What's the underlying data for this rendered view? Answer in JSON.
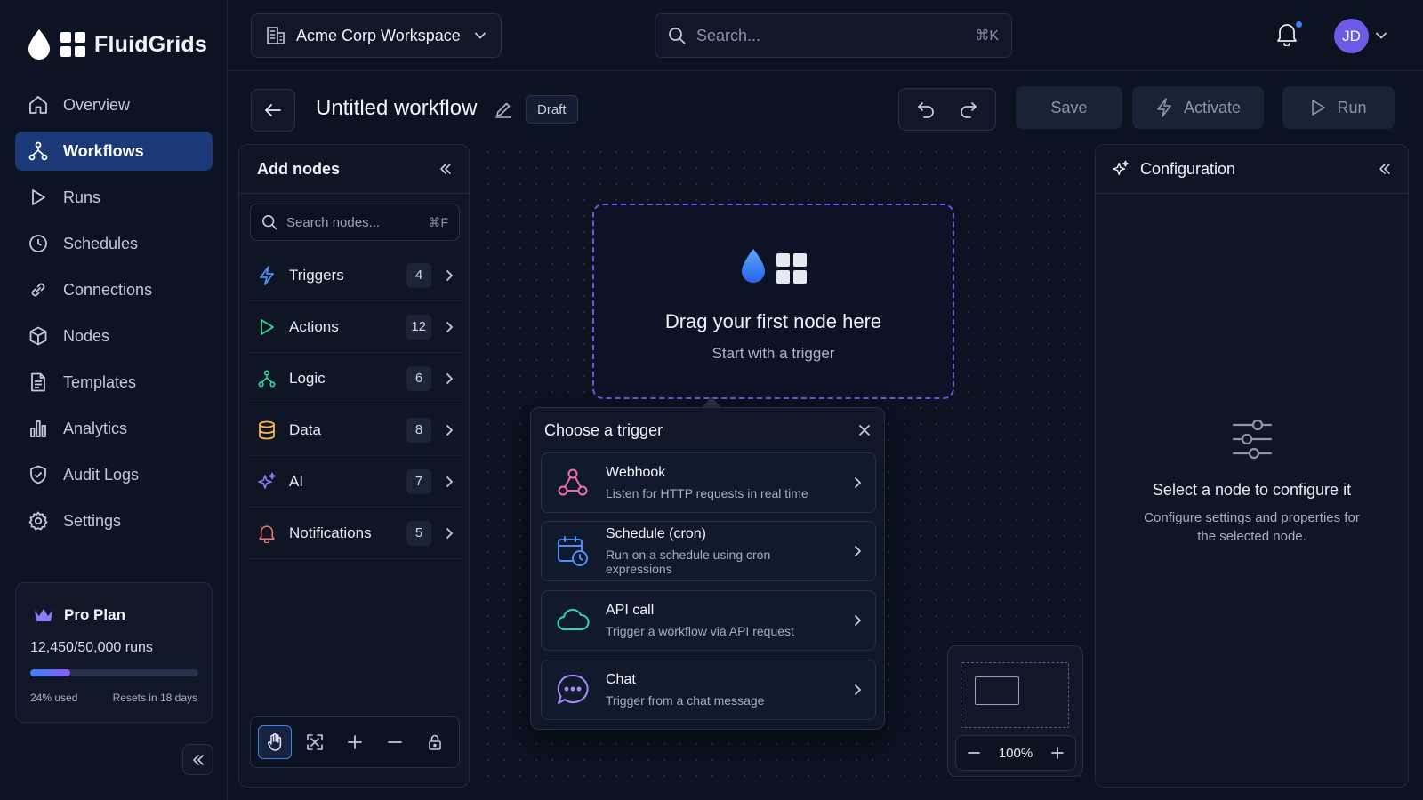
{
  "app": {
    "name": "FluidGrids"
  },
  "sidebar": {
    "items": [
      {
        "label": "Overview",
        "icon": "home-icon",
        "active": false
      },
      {
        "label": "Workflows",
        "icon": "workflow-icon",
        "active": true
      },
      {
        "label": "Runs",
        "icon": "play-icon",
        "active": false
      },
      {
        "label": "Schedules",
        "icon": "clock-icon",
        "active": false
      },
      {
        "label": "Connections",
        "icon": "link-icon",
        "active": false
      },
      {
        "label": "Nodes",
        "icon": "cube-icon",
        "active": false
      },
      {
        "label": "Templates",
        "icon": "document-icon",
        "active": false
      },
      {
        "label": "Analytics",
        "icon": "bar-chart-icon",
        "active": false
      },
      {
        "label": "Audit Logs",
        "icon": "shield-icon",
        "active": false
      },
      {
        "label": "Settings",
        "icon": "gear-icon",
        "active": false
      }
    ],
    "plan": {
      "name": "Pro Plan",
      "runs": "12,450/50,000 runs",
      "used_fraction": 0.24,
      "used_label": "24% used",
      "reset_label": "Resets in 18 days"
    }
  },
  "topbar": {
    "workspace": "Acme Corp Workspace",
    "search_placeholder": "Search...",
    "search_shortcut": "⌘K",
    "avatar_initials": "JD"
  },
  "workflow": {
    "title": "Untitled workflow",
    "status": "Draft",
    "save_label": "Save",
    "activate_label": "Activate",
    "run_label": "Run"
  },
  "add_nodes": {
    "title": "Add nodes",
    "search_placeholder": "Search nodes...",
    "search_shortcut": "⌘F",
    "categories": [
      {
        "label": "Triggers",
        "count": "4",
        "icon": "bolt-icon",
        "color": "#4f8ef7"
      },
      {
        "label": "Actions",
        "count": "12",
        "icon": "play-icon",
        "color": "#34d399"
      },
      {
        "label": "Logic",
        "count": "6",
        "icon": "branch-icon",
        "color": "#34d399"
      },
      {
        "label": "Data",
        "count": "8",
        "icon": "database-icon",
        "color": "#f5b94a"
      },
      {
        "label": "AI",
        "count": "7",
        "icon": "sparkle-icon",
        "color": "#8b7cf6"
      },
      {
        "label": "Notifications",
        "count": "5",
        "icon": "bell-icon",
        "color": "#f47272"
      }
    ]
  },
  "canvas": {
    "drop_title": "Drag your first node here",
    "drop_subtitle": "Start with a trigger",
    "zoom": "100%"
  },
  "trigger_picker": {
    "title": "Choose a trigger",
    "options": [
      {
        "title": "Webhook",
        "subtitle": "Listen for HTTP requests in real time",
        "icon": "webhook-icon"
      },
      {
        "title": "Schedule (cron)",
        "subtitle": "Run on a schedule using cron expressions",
        "icon": "calendar-clock-icon"
      },
      {
        "title": "API call",
        "subtitle": "Trigger a workflow via API request",
        "icon": "cloud-icon"
      },
      {
        "title": "Chat",
        "subtitle": "Trigger from a chat message",
        "icon": "chat-icon"
      }
    ]
  },
  "configuration": {
    "title": "Configuration",
    "empty_title": "Select a node to configure it",
    "empty_subtitle": "Configure settings and properties for the selected node."
  },
  "colors": {
    "accent": "#3b82f6",
    "brand_purple": "#6d5be8",
    "active_nav": "#1c3a78"
  }
}
